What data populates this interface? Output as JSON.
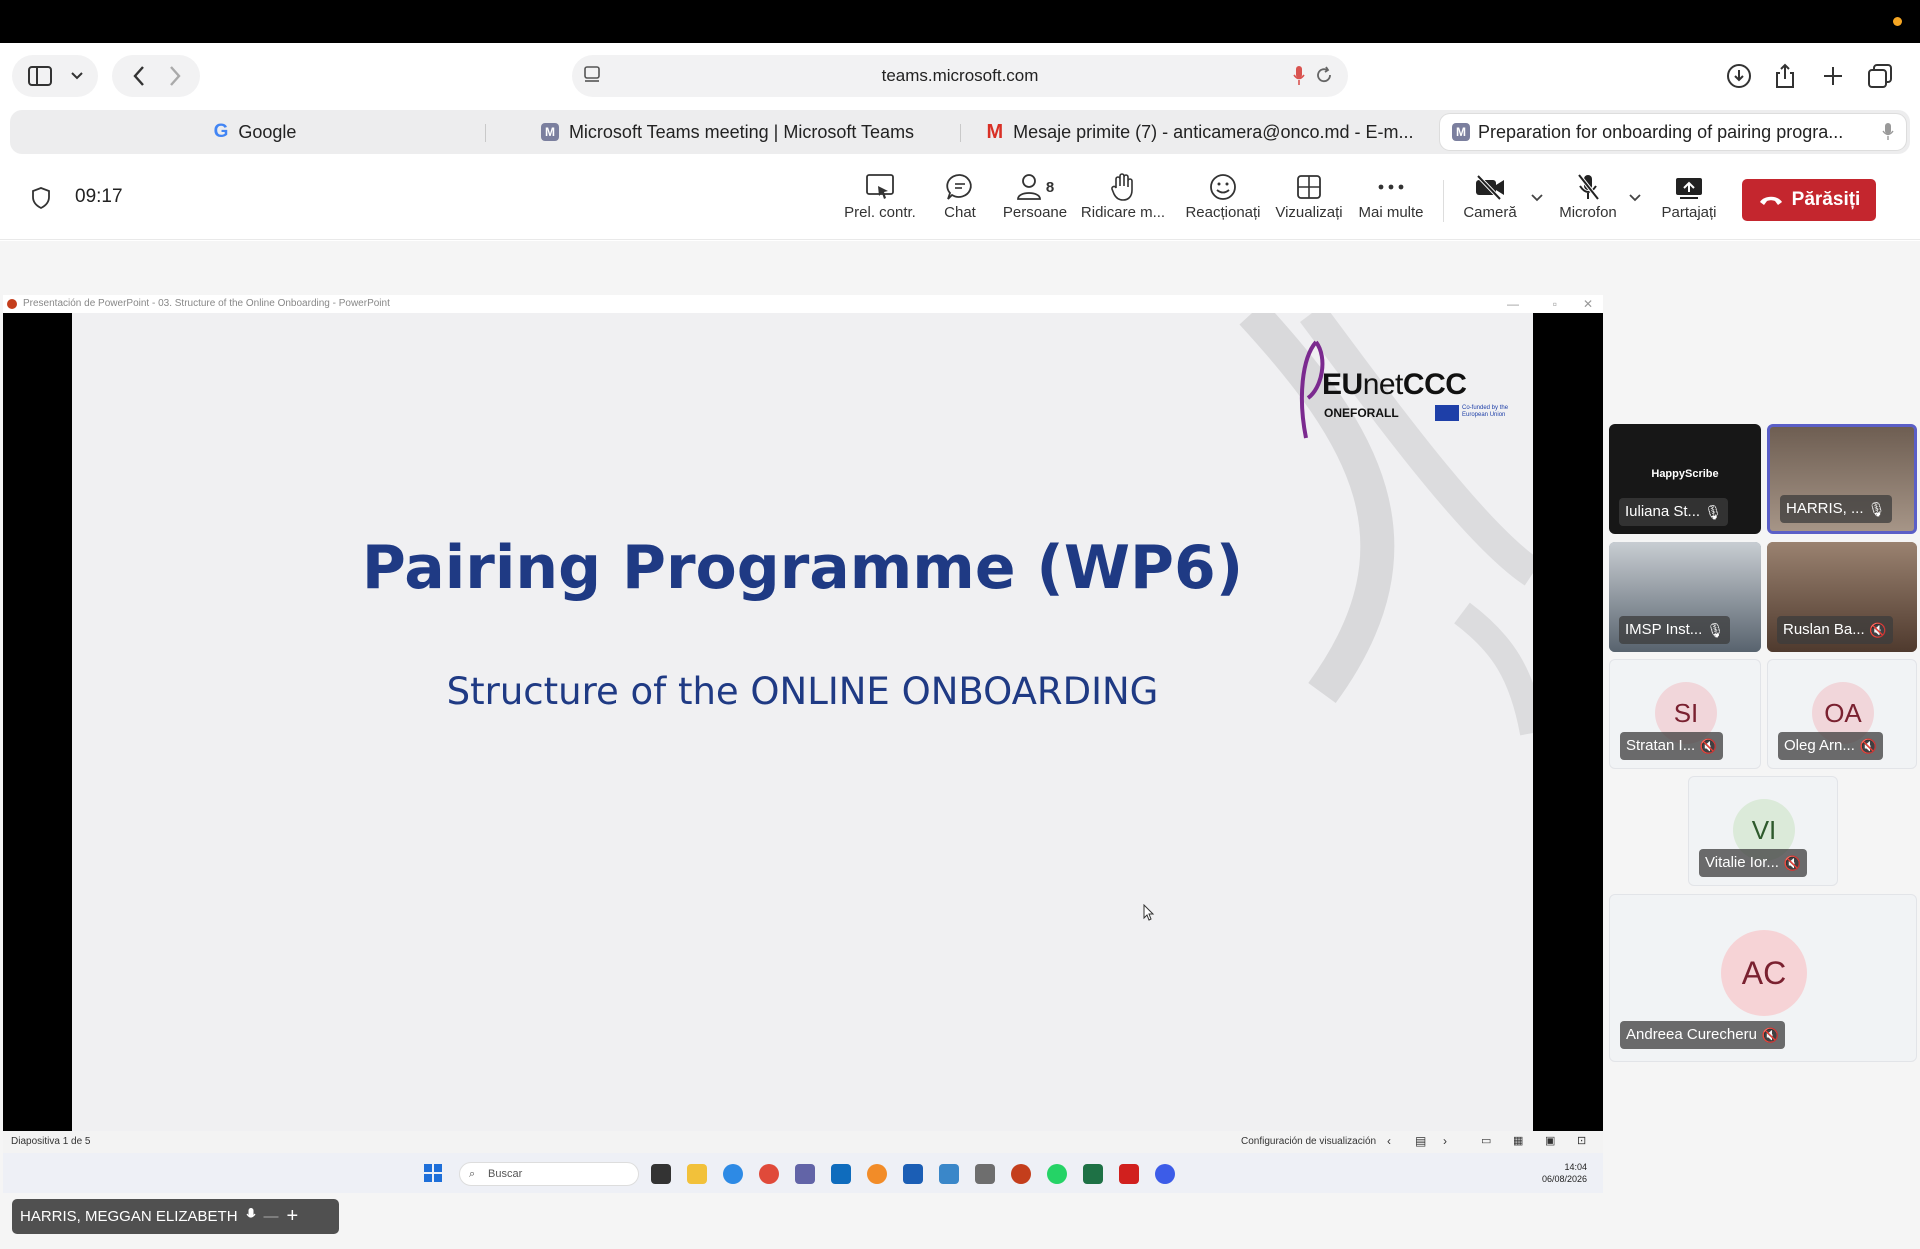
{
  "browser": {
    "address": "teams.microsoft.com",
    "tabs": [
      {
        "label": "Google",
        "icon": "google-icon"
      },
      {
        "label": "Microsoft Teams meeting | Microsoft Teams",
        "icon": "teams-m-icon"
      },
      {
        "label": "Mesaje primite (7) - anticamera@onco.md - E-m...",
        "icon": "gmail-icon"
      },
      {
        "label": "Preparation for onboarding of pairing progra...",
        "icon": "teams-m-icon"
      }
    ]
  },
  "meeting": {
    "time": "09:17",
    "controls": {
      "share_control": "Prel. contr.",
      "chat": "Chat",
      "people": "Persoane",
      "people_count": "8",
      "raise_hand": "Ridicare m...",
      "react": "Reacționați",
      "view": "Vizualizați",
      "more": "Mai multe",
      "camera": "Cameră",
      "mic": "Microfon",
      "share": "Partajați",
      "leave": "Părăsiți"
    }
  },
  "shared": {
    "window_title": "Presentación de PowerPoint - 03. Structure of the Online Onboarding - PowerPoint",
    "slide_title": "Pairing Programme (WP6)",
    "slide_subtitle": "Structure of the ONLINE ONBOARDING",
    "logo_main_a": "EU",
    "logo_main_b": "net",
    "logo_main_c": "CCC",
    "logo_sub": "ONEFORALL",
    "logo_eu_text": "Co-funded by the European Union",
    "status_left": "Diapositiva 1 de 5",
    "status_right": "Configuración de visualización",
    "taskbar_search": "Buscar",
    "clock_time": "14:04",
    "clock_date": "06/08/2026"
  },
  "presenter": {
    "name": "HARRIS, MEGGAN ELIZABETH"
  },
  "participants": [
    {
      "name": "Iuliana St...",
      "tile_text": "HappyScribe"
    },
    {
      "name": "HARRIS, ..."
    },
    {
      "name": "IMSP Inst..."
    },
    {
      "name": "Ruslan Ba..."
    },
    {
      "name": "Stratan I...",
      "initials": "SI"
    },
    {
      "name": "Oleg Arn...",
      "initials": "OA"
    },
    {
      "name": "Vitalie Ior...",
      "initials": "VI"
    },
    {
      "name": "Andreea Curecheru",
      "initials": "AC"
    }
  ],
  "colors": {
    "leave": "#c4262e",
    "slide_text": "#1f3a84",
    "active_speaker_border": "#5b5fc7"
  }
}
